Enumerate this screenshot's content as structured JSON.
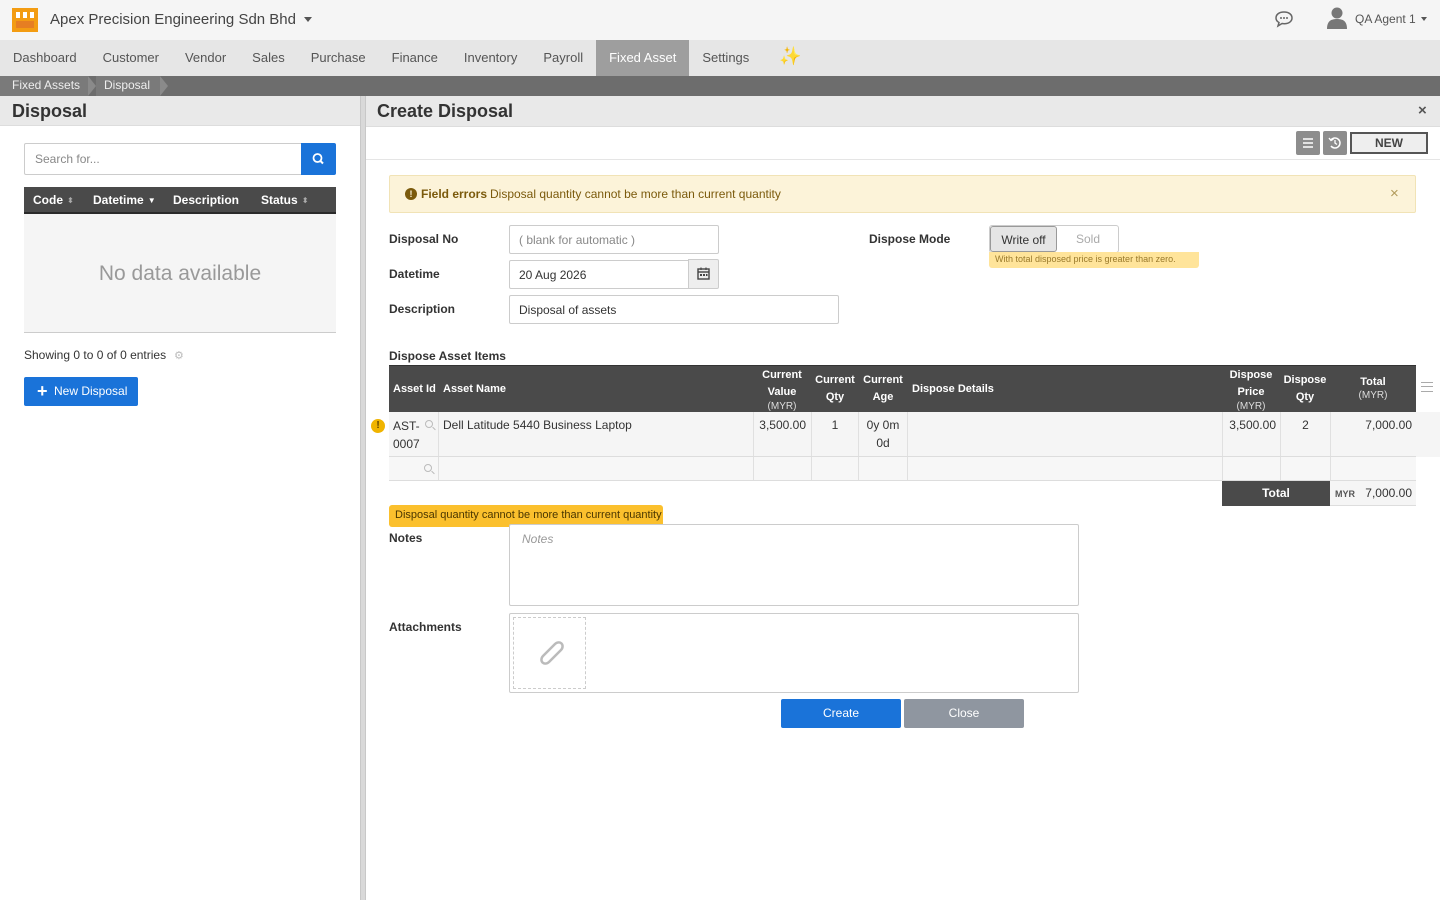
{
  "header": {
    "company": "Apex Precision Engineering Sdn Bhd",
    "user": "QA Agent 1"
  },
  "nav": {
    "items": [
      "Dashboard",
      "Customer",
      "Vendor",
      "Sales",
      "Purchase",
      "Finance",
      "Inventory",
      "Payroll",
      "Fixed Asset",
      "Settings"
    ],
    "active": "Fixed Asset"
  },
  "breadcrumb": [
    "Fixed Assets",
    "Disposal"
  ],
  "left": {
    "title": "Disposal",
    "search_placeholder": "Search for...",
    "columns": [
      "Code",
      "Datetime",
      "Description",
      "Status"
    ],
    "empty_text": "No data available",
    "showing": "Showing 0 to 0 of 0 entries",
    "new_button": "New Disposal"
  },
  "form": {
    "title": "Create Disposal",
    "close_symbol": "×",
    "new_label": "NEW",
    "alert": {
      "icon": "!",
      "title": "Field errors",
      "message": "Disposal quantity cannot be more than current quantity",
      "close": "×"
    },
    "disposal_no": {
      "label": "Disposal No",
      "placeholder": "( blank for automatic )",
      "value": ""
    },
    "datetime": {
      "label": "Datetime",
      "value": "20 Aug 2026"
    },
    "description": {
      "label": "Description",
      "value": "Disposal of assets"
    },
    "dispose_mode": {
      "label": "Dispose Mode",
      "options": [
        "Write off",
        "Sold"
      ],
      "selected": "Write off",
      "hint": "With total disposed price is greater than zero."
    },
    "items_title": "Dispose Asset Items",
    "columns": {
      "asset_id": "Asset Id",
      "asset_name": "Asset Name",
      "current_value": [
        "Current",
        "Value"
      ],
      "current_value_unit": "(MYR)",
      "current_qty": [
        "Current",
        "Qty"
      ],
      "current_age": [
        "Current",
        "Age"
      ],
      "dispose_details": "Dispose Details",
      "dispose_price": [
        "Dispose",
        "Price"
      ],
      "dispose_price_unit": "(MYR)",
      "dispose_qty": [
        "Dispose",
        "Qty"
      ],
      "total": "Total",
      "total_unit": "(MYR)"
    },
    "rows": [
      {
        "asset_id_1": "AST-",
        "asset_id_2": "0007",
        "asset_name": "Dell Latitude 5440 Business Laptop",
        "current_value": "3,500.00",
        "current_qty": "1",
        "current_age_1": "0y 0m",
        "current_age_2": "0d",
        "dispose_details": "",
        "dispose_price": "3,500.00",
        "dispose_qty": "2",
        "total": "7,000.00"
      }
    ],
    "row_warning_icon": "!",
    "total_label": "Total",
    "total_currency": "MYR",
    "total_value": "7,000.00",
    "row_error": "Disposal quantity cannot be more than current quantity",
    "notes": {
      "label": "Notes",
      "placeholder": "Notes"
    },
    "attachments": {
      "label": "Attachments"
    },
    "create_button": "Create",
    "close_button": "Close"
  },
  "colors": {
    "primary": "#1a73d9",
    "nav_active": "#9e9e9e",
    "table_header": "#4a4a4a",
    "warning": "#fbc02d",
    "alert_bg": "#fcf3d9"
  }
}
